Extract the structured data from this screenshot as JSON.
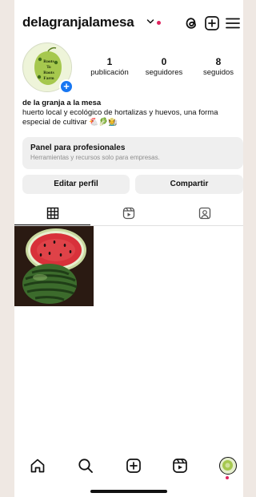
{
  "profile": {
    "username": "delagranjalamesa",
    "display_name": "de la granja a la mesa",
    "bio": "huerto local y ecológico de hortalizas y huevos, una forma especial de cultivar 🐔🥬🧑‍🌾",
    "avatar_text": "Roots To Roots Farm"
  },
  "stats": [
    {
      "value": "1",
      "label": "publicación"
    },
    {
      "value": "0",
      "label": "seguidores"
    },
    {
      "value": "8",
      "label": "seguidos"
    }
  ],
  "pro_panel": {
    "title": "Panel para profesionales",
    "subtitle": "Herramientas y recursos solo para empresas."
  },
  "buttons": {
    "edit": "Editar perfil",
    "share": "Compartir"
  },
  "tabs": [
    {
      "icon": "grid-icon",
      "active": true
    },
    {
      "icon": "reels-icon",
      "active": false
    },
    {
      "icon": "tagged-icon",
      "active": false
    }
  ],
  "posts": [
    {
      "description": "watermelon-photo"
    }
  ],
  "topbar_icons": [
    "threads-icon",
    "add-icon",
    "menu-icon"
  ],
  "bottom_nav": [
    "home-icon",
    "search-icon",
    "create-icon",
    "reels-icon",
    "profile-avatar"
  ],
  "colors": {
    "accent_blue": "#1877f2",
    "notification_red": "#e0245e",
    "surface_gray": "#efefef"
  }
}
